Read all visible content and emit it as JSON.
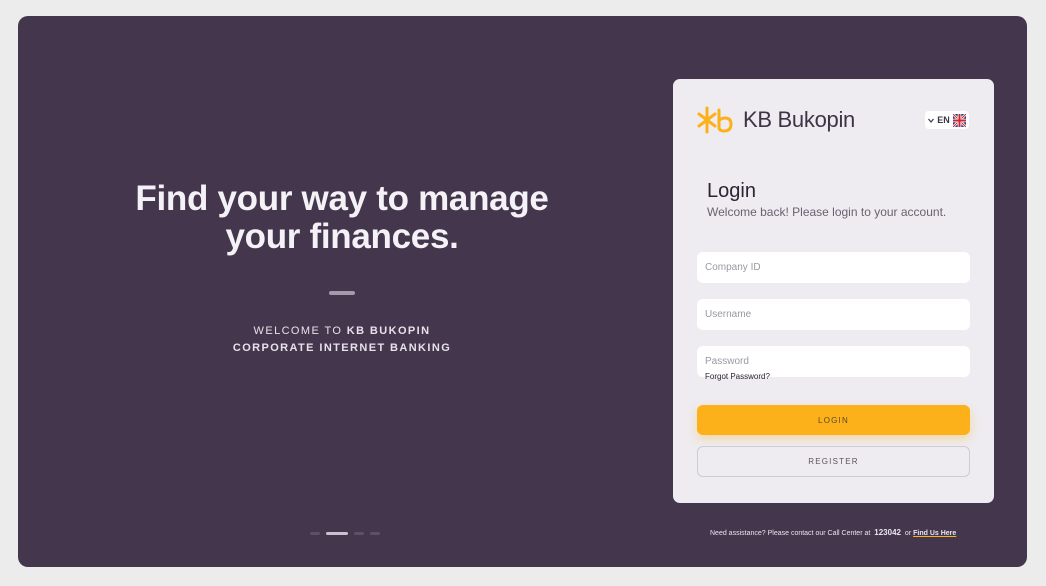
{
  "hero": {
    "title": "Find your way to manage your finances.",
    "welcome_prefix": "WELCOME TO ",
    "welcome_brand": "KB BUKOPIN",
    "welcome_line2": "CORPORATE INTERNET BANKING"
  },
  "carousel": {
    "active_index": 1,
    "count": 4
  },
  "logo": {
    "text": "KB Bukopin"
  },
  "lang": {
    "code": "EN"
  },
  "login": {
    "title": "Login",
    "subtitle": "Welcome back! Please login to your account.",
    "company_placeholder": "Company ID",
    "username_placeholder": "Username",
    "password_placeholder": "Password",
    "forgot": "Forgot Password?",
    "login_label": "LOGIN",
    "register_label": "REGISTER"
  },
  "footer": {
    "help_text": "Need assistance? Please contact our Call Center at",
    "phone": "123042",
    "or": "or",
    "find_us": "Find Us Here"
  },
  "colors": {
    "panel": "#44374d",
    "card": "#eeecf1",
    "accent": "#fcb11a"
  }
}
